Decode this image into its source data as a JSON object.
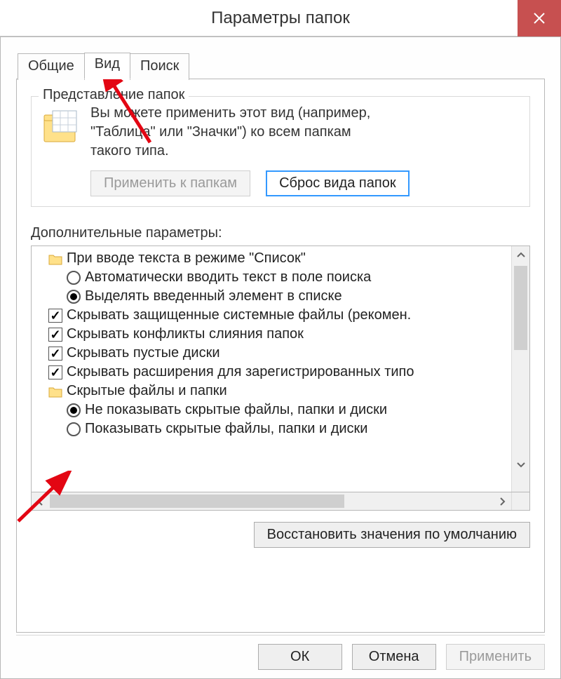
{
  "window": {
    "title": "Параметры папок"
  },
  "tabs": {
    "general": "Общие",
    "view": "Вид",
    "search": "Поиск"
  },
  "folderViews": {
    "legend": "Представление папок",
    "desc_l1": "Вы можете применить этот вид (например,",
    "desc_l2": "\"Таблица\" или \"Значки\") ко всем папкам",
    "desc_l3": "такого типа.",
    "apply_btn": "Применить к папкам",
    "reset_btn": "Сброс вида папок"
  },
  "advanced": {
    "label": "Дополнительные параметры:",
    "items": [
      {
        "kind": "folder",
        "indent": 1,
        "text": "При вводе текста в режиме \"Список\""
      },
      {
        "kind": "radio",
        "indent": 2,
        "checked": false,
        "text": "Автоматически вводить текст в поле поиска"
      },
      {
        "kind": "radio",
        "indent": 2,
        "checked": true,
        "text": "Выделять введенный элемент в списке"
      },
      {
        "kind": "check",
        "indent": 1,
        "checked": true,
        "text": "Скрывать защищенные системные файлы (рекомен."
      },
      {
        "kind": "check",
        "indent": 1,
        "checked": true,
        "text": "Скрывать конфликты слияния папок"
      },
      {
        "kind": "check",
        "indent": 1,
        "checked": true,
        "text": "Скрывать пустые диски"
      },
      {
        "kind": "check",
        "indent": 1,
        "checked": true,
        "text": "Скрывать расширения для зарегистрированных типо"
      },
      {
        "kind": "folder",
        "indent": 1,
        "text": "Скрытые файлы и папки"
      },
      {
        "kind": "radio",
        "indent": 2,
        "checked": true,
        "text": "Не показывать скрытые файлы, папки и диски"
      },
      {
        "kind": "radio",
        "indent": 2,
        "checked": false,
        "text": "Показывать скрытые файлы, папки и диски"
      }
    ],
    "restore_btn": "Восстановить значения по умолчанию"
  },
  "footer": {
    "ok": "ОК",
    "cancel": "Отмена",
    "apply": "Применить"
  }
}
